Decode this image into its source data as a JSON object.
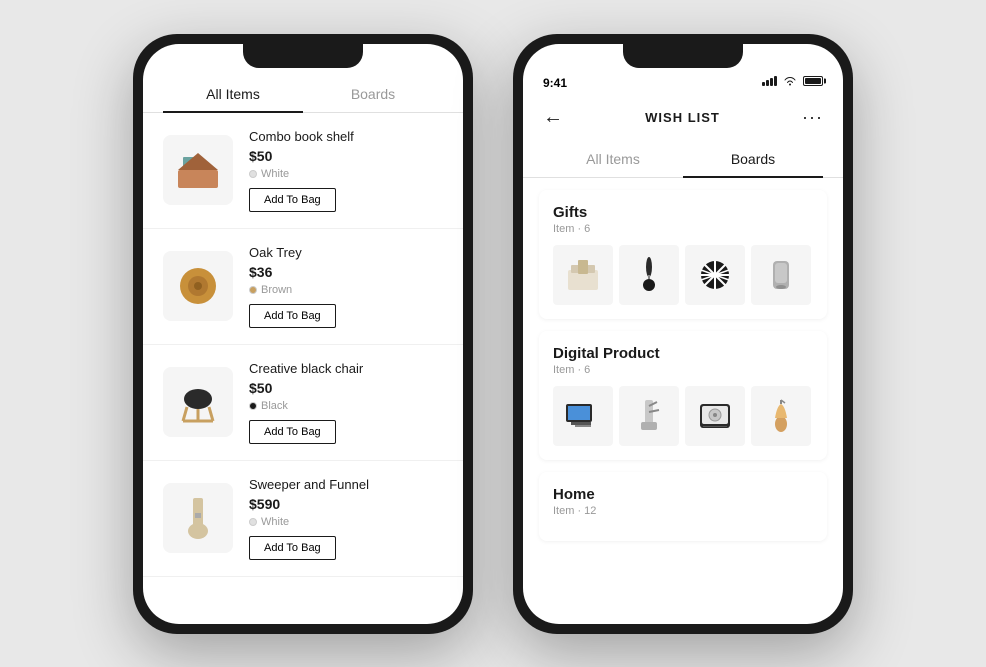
{
  "left_phone": {
    "tabs": [
      {
        "label": "All Items",
        "active": true
      },
      {
        "label": "Boards",
        "active": false
      }
    ],
    "products": [
      {
        "name": "Combo book shelf",
        "price": "$50",
        "color": "White",
        "color_hex": "#e0e0e0",
        "emoji": "🪵",
        "add_label": "Add To Bag"
      },
      {
        "name": "Oak Trey",
        "price": "$36",
        "color": "Brown",
        "color_hex": "#c8a060",
        "emoji": "🪵",
        "add_label": "Add To Bag"
      },
      {
        "name": "Creative black chair",
        "price": "$50",
        "color": "Black",
        "color_hex": "#1a1a1a",
        "emoji": "🪑",
        "add_label": "Add To Bag"
      },
      {
        "name": "Sweeper and Funnel",
        "price": "$590",
        "color": "White",
        "color_hex": "#e0e0e0",
        "emoji": "🧹",
        "add_label": "Add To Bag"
      }
    ]
  },
  "right_phone": {
    "status_time": "9:41",
    "nav": {
      "back_icon": "←",
      "title": "WISH LIST",
      "more_icon": "···"
    },
    "tabs": [
      {
        "label": "All Items",
        "active": false
      },
      {
        "label": "Boards",
        "active": true
      }
    ],
    "boards": [
      {
        "title": "Gifts",
        "count": "Item · 6",
        "items": [
          "🪣",
          "🖤",
          "❄️",
          "🥤"
        ]
      },
      {
        "title": "Digital Product",
        "count": "Item · 6",
        "items": [
          "💻",
          "🔦",
          "🖥️",
          "🧴"
        ]
      },
      {
        "title": "Home",
        "count": "Item · 12",
        "items": []
      }
    ]
  }
}
